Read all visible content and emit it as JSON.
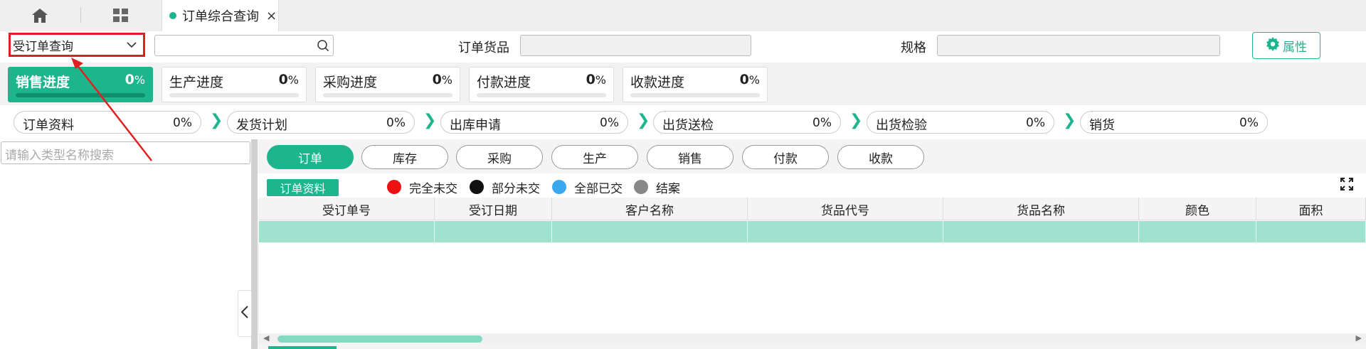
{
  "tabs": {
    "home_icon": "home-icon",
    "apps_icon": "grid-icon",
    "active_tab_label": "订单综合查询",
    "close_glyph": "×"
  },
  "query": {
    "selected_query": "受订单查询",
    "search_value": "",
    "goods_label": "订单货品",
    "goods_value": "",
    "spec_label": "规格",
    "spec_value": "",
    "properties_button": "属性"
  },
  "progress": [
    {
      "label": "销售进度",
      "value": "0",
      "unit": "%",
      "fill": 0,
      "active": true
    },
    {
      "label": "生产进度",
      "value": "0",
      "unit": "%",
      "fill": 0,
      "active": false
    },
    {
      "label": "采购进度",
      "value": "0",
      "unit": "%",
      "fill": 0,
      "active": false
    },
    {
      "label": "付款进度",
      "value": "0",
      "unit": "%",
      "fill": 0,
      "active": false
    },
    {
      "label": "收款进度",
      "value": "0",
      "unit": "%",
      "fill": 0,
      "active": false
    }
  ],
  "flow": [
    {
      "label": "订单资料",
      "value": "0%"
    },
    {
      "label": "发货计划",
      "value": "0%"
    },
    {
      "label": "出库申请",
      "value": "0%"
    },
    {
      "label": "出货送检",
      "value": "0%"
    },
    {
      "label": "出货检验",
      "value": "0%"
    },
    {
      "label": "销货",
      "value": "0%"
    }
  ],
  "flow_arrow": "❯",
  "tree": {
    "search_placeholder": "请输入类型名称搜索"
  },
  "panel_tabs": [
    "订单",
    "库存",
    "采购",
    "生产",
    "销售",
    "付款",
    "收款"
  ],
  "section_badge": "订单资料",
  "legend": [
    {
      "label": "完全未交",
      "color": "#ee1111"
    },
    {
      "label": "部分未交",
      "color": "#111111"
    },
    {
      "label": "全部已交",
      "color": "#3aa8f0"
    },
    {
      "label": "结案",
      "color": "#888888"
    }
  ],
  "grid": {
    "columns": [
      "受订单号",
      "受订日期",
      "客户名称",
      "货品代号",
      "货品名称",
      "颜色",
      "面积"
    ],
    "rows": [
      [
        "",
        "",
        "",
        "",
        "",
        "",
        ""
      ]
    ]
  },
  "colors": {
    "accent": "#1db58d",
    "highlight": "#e02020",
    "selected_row": "#9fe3cf"
  }
}
